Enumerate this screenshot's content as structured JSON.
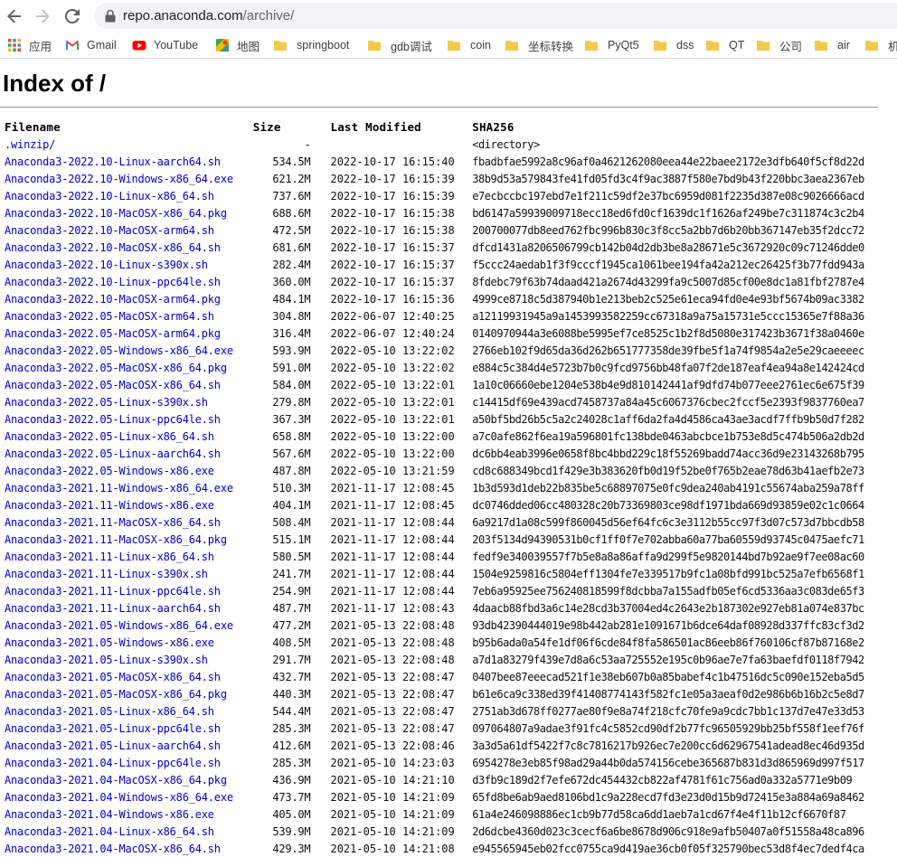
{
  "browser": {
    "url_host": "repo.anaconda.com",
    "url_path": "/archive/",
    "bookmarks": [
      {
        "label": "应用",
        "icon": "apps-grid-icon"
      },
      {
        "label": "Gmail",
        "icon": "gmail-icon"
      },
      {
        "label": "YouTube",
        "icon": "youtube-icon"
      },
      {
        "label": "地图",
        "icon": "maps-icon"
      },
      {
        "label": "springboot",
        "icon": "folder-icon"
      },
      {
        "label": "gdb调试",
        "icon": "folder-icon"
      },
      {
        "label": "coin",
        "icon": "folder-icon"
      },
      {
        "label": "坐标转换",
        "icon": "folder-icon"
      },
      {
        "label": "PyQt5",
        "icon": "folder-icon"
      },
      {
        "label": "dss",
        "icon": "folder-icon"
      },
      {
        "label": "QT",
        "icon": "folder-icon"
      },
      {
        "label": "公司",
        "icon": "folder-icon"
      },
      {
        "label": "air",
        "icon": "folder-icon"
      },
      {
        "label": "机",
        "icon": "folder-icon"
      }
    ]
  },
  "page": {
    "title": "Index of /",
    "columns": [
      "Filename",
      "Size",
      "Last Modified",
      "SHA256"
    ],
    "rows": [
      {
        "name": ".winzip/",
        "size": "-",
        "modified": "",
        "sha": "<directory>"
      },
      {
        "name": "Anaconda3-2022.10-Linux-aarch64.sh",
        "size": "534.5M",
        "modified": "2022-10-17 16:15:40",
        "sha": "fbadbfae5992a8c96af0a4621262080eea44e22baee2172e3dfb640f5cf8d22d"
      },
      {
        "name": "Anaconda3-2022.10-Windows-x86_64.exe",
        "size": "621.2M",
        "modified": "2022-10-17 16:15:39",
        "sha": "38b9d53a579843fe41fd05fd3c4f9ac3887f580e7bd9b43f220bbc3aea2367eb"
      },
      {
        "name": "Anaconda3-2022.10-Linux-x86_64.sh",
        "size": "737.6M",
        "modified": "2022-10-17 16:15:39",
        "sha": "e7ecbccbc197ebd7e1f211c59df2e37bc6959d081f2235d387e08c9026666acd"
      },
      {
        "name": "Anaconda3-2022.10-MacOSX-x86_64.pkg",
        "size": "688.6M",
        "modified": "2022-10-17 16:15:38",
        "sha": "bd6147a59939009718ecc18ed6fd0cf1639dc1f1626af249be7c311874c3c2b4"
      },
      {
        "name": "Anaconda3-2022.10-MacOSX-arm64.sh",
        "size": "472.5M",
        "modified": "2022-10-17 16:15:38",
        "sha": "200700077db8eed762fbc996b830c3f8cc5a2bb7d6b20bb367147eb35f2dcc72"
      },
      {
        "name": "Anaconda3-2022.10-MacOSX-x86_64.sh",
        "size": "681.6M",
        "modified": "2022-10-17 16:15:37",
        "sha": "dfcd1431a8206506799cb142b04d2db3be8a28671e5c3672920c09c71246dde0"
      },
      {
        "name": "Anaconda3-2022.10-Linux-s390x.sh",
        "size": "282.4M",
        "modified": "2022-10-17 16:15:37",
        "sha": "f5ccc24aedab1f3f9cccf1945ca1061bee194fa42a212ec26425f3b77fdd943a"
      },
      {
        "name": "Anaconda3-2022.10-Linux-ppc64le.sh",
        "size": "360.0M",
        "modified": "2022-10-17 16:15:37",
        "sha": "8fdebc79f63b74daad421a2674d43299fa9c5007d85cf00e8dc1a81fbf2787e4"
      },
      {
        "name": "Anaconda3-2022.10-MacOSX-arm64.pkg",
        "size": "484.1M",
        "modified": "2022-10-17 16:15:36",
        "sha": "4999ce8718c5d387940b1e213beb2c525e61eca94fd0e4e93bf5674b09ac3382"
      },
      {
        "name": "Anaconda3-2022.05-MacOSX-arm64.sh",
        "size": "304.8M",
        "modified": "2022-06-07 12:40:25",
        "sha": "a12119931945a9a1453993582259cc67318a9a75a15731e5ccc15365e7f88a36"
      },
      {
        "name": "Anaconda3-2022.05-MacOSX-arm64.pkg",
        "size": "316.4M",
        "modified": "2022-06-07 12:40:24",
        "sha": "0140970944a3e6088be5995ef7ce8525c1b2f8d5080e317423b3671f38a0460e"
      },
      {
        "name": "Anaconda3-2022.05-Windows-x86_64.exe",
        "size": "593.9M",
        "modified": "2022-05-10 13:22:02",
        "sha": "2766eb102f9d65da36d262b651777358de39fbe5f1a74f9854a2e5e29caeeeec"
      },
      {
        "name": "Anaconda3-2022.05-MacOSX-x86_64.pkg",
        "size": "591.0M",
        "modified": "2022-05-10 13:22:02",
        "sha": "e884c5c384d4e5723b7b0c9fcd9756bb48fa07f2de187eaf4ea94a8e142424cd"
      },
      {
        "name": "Anaconda3-2022.05-MacOSX-x86_64.sh",
        "size": "584.0M",
        "modified": "2022-05-10 13:22:01",
        "sha": "1a10c06660ebe1204e538b4e9d810142441af9dfd74b077eee2761ec6e675f39"
      },
      {
        "name": "Anaconda3-2022.05-Linux-s390x.sh",
        "size": "279.8M",
        "modified": "2022-05-10 13:22:01",
        "sha": "c14415df69e439acd7458737a84a45c6067376cbec2fccf5e2393f9837760ea7"
      },
      {
        "name": "Anaconda3-2022.05-Linux-ppc64le.sh",
        "size": "367.3M",
        "modified": "2022-05-10 13:22:01",
        "sha": "a50bf5bd26b5c5a2c24028c1aff6da2fa4d4586ca43ae3acdf7ffb9b50d7f282"
      },
      {
        "name": "Anaconda3-2022.05-Linux-x86_64.sh",
        "size": "658.8M",
        "modified": "2022-05-10 13:22:00",
        "sha": "a7c0afe862f6ea19a596801fc138bde0463abcbce1b753e8d5c474b506a2db2d"
      },
      {
        "name": "Anaconda3-2022.05-Linux-aarch64.sh",
        "size": "567.6M",
        "modified": "2022-05-10 13:22:00",
        "sha": "dc6bb4eab3996e0658f8bc4bbd229c18f55269badd74acc36d9e23143268b795"
      },
      {
        "name": "Anaconda3-2022.05-Windows-x86.exe",
        "size": "487.8M",
        "modified": "2022-05-10 13:21:59",
        "sha": "cd8c688349bcd1f429e3b383620fb0d19f52be0f765b2eae78d63b41aefb2e73"
      },
      {
        "name": "Anaconda3-2021.11-Windows-x86_64.exe",
        "size": "510.3M",
        "modified": "2021-11-17 12:08:45",
        "sha": "1b3d593d1deb22b835be5c68897075e0fc9dea240ab4191c55674aba259a78ff"
      },
      {
        "name": "Anaconda3-2021.11-Windows-x86.exe",
        "size": "404.1M",
        "modified": "2021-11-17 12:08:45",
        "sha": "dc0746dded06cc480328c20b73369803ce98df1971bda669d93859e02c1c0664"
      },
      {
        "name": "Anaconda3-2021.11-MacOSX-x86_64.sh",
        "size": "508.4M",
        "modified": "2021-11-17 12:08:44",
        "sha": "6a9217d1a08c599f860045d56ef64fc6c3e3112b55cc97f3d07c573d7bbcdb58"
      },
      {
        "name": "Anaconda3-2021.11-MacOSX-x86_64.pkg",
        "size": "515.1M",
        "modified": "2021-11-17 12:08:44",
        "sha": "203f5134d94390531b0cf1ff0f7e702abba60a77ba60559d93745c0475aefc71"
      },
      {
        "name": "Anaconda3-2021.11-Linux-x86_64.sh",
        "size": "580.5M",
        "modified": "2021-11-17 12:08:44",
        "sha": "fedf9e340039557f7b5e8a8a86affa9d299f5e9820144bd7b92ae9f7ee08ac60"
      },
      {
        "name": "Anaconda3-2021.11-Linux-s390x.sh",
        "size": "241.7M",
        "modified": "2021-11-17 12:08:44",
        "sha": "1504e9259816c5804eff1304fe7e339517b9fc1a08bfd991bc525a7efb6568f1"
      },
      {
        "name": "Anaconda3-2021.11-Linux-ppc64le.sh",
        "size": "254.9M",
        "modified": "2021-11-17 12:08:44",
        "sha": "7eb6a95925ee756240818599f8dcbba7a155adfb05ef6cd5336aa3c083de65f3"
      },
      {
        "name": "Anaconda3-2021.11-Linux-aarch64.sh",
        "size": "487.7M",
        "modified": "2021-11-17 12:08:43",
        "sha": "4daacb88fbd3a6c14e28cd3b37004ed4c2643e2b187302e927eb81a074e837bc"
      },
      {
        "name": "Anaconda3-2021.05-Windows-x86_64.exe",
        "size": "477.2M",
        "modified": "2021-05-13 22:08:48",
        "sha": "93db42390444019e98b442ab281e1091671b6dce64daf08928d337ffc83cf3d2"
      },
      {
        "name": "Anaconda3-2021.05-Windows-x86.exe",
        "size": "408.5M",
        "modified": "2021-05-13 22:08:48",
        "sha": "b95b6ada0a54fe1df06f6cde84f8fa586501ac86eeb86f760106cf87b87168e2"
      },
      {
        "name": "Anaconda3-2021.05-Linux-s390x.sh",
        "size": "291.7M",
        "modified": "2021-05-13 22:08:48",
        "sha": "a7d1a83279f439e7d8a6c53aa725552e195c0b96ae7e7fa63baefdf0118f7942"
      },
      {
        "name": "Anaconda3-2021.05-MacOSX-x86_64.sh",
        "size": "432.7M",
        "modified": "2021-05-13 22:08:47",
        "sha": "0407bee87eeecad521f1e38eb607b0a85babef4c1b47516dc5c090e152eba5d5"
      },
      {
        "name": "Anaconda3-2021.05-MacOSX-x86_64.pkg",
        "size": "440.3M",
        "modified": "2021-05-13 22:08:47",
        "sha": "b61e6ca9c338ed39f41408774143f582fc1e05a3aeaf0d2e986b6b16b2c5e8d7"
      },
      {
        "name": "Anaconda3-2021.05-Linux-x86_64.sh",
        "size": "544.4M",
        "modified": "2021-05-13 22:08:47",
        "sha": "2751ab3d678ff0277ae80f9e8a74f218cfc70fe9a9cdc7bb1c137d7e47e33d53"
      },
      {
        "name": "Anaconda3-2021.05-Linux-ppc64le.sh",
        "size": "285.3M",
        "modified": "2021-05-13 22:08:47",
        "sha": "097064807a9adae3f91fc4c5852cd90df2b77fc96505929bb25bf558f1eef76f"
      },
      {
        "name": "Anaconda3-2021.05-Linux-aarch64.sh",
        "size": "412.6M",
        "modified": "2021-05-13 22:08:46",
        "sha": "3a3d5a61df5422f7c8c7816217b926ec7e200cc6d62967541adead8ec46d935d"
      },
      {
        "name": "Anaconda3-2021.04-Linux-ppc64le.sh",
        "size": "285.3M",
        "modified": "2021-05-10 14:23:03",
        "sha": "6954278e3eb85f98ad29a44b0da574156cebe365687b831d3d865969d997f517"
      },
      {
        "name": "Anaconda3-2021.04-MacOSX-x86_64.pkg",
        "size": "436.9M",
        "modified": "2021-05-10 14:21:10",
        "sha": "d3fb9c189d2f7efe672dc454432cb822af4781f61c756ad0a332a5771e9b09"
      },
      {
        "name": "Anaconda3-2021.04-Windows-x86_64.exe",
        "size": "473.7M",
        "modified": "2021-05-10 14:21:09",
        "sha": "65fd8be6ab9aed8106bd1c9a228ecd7fd3e23d0d15b9d72415e3a884a69a8462"
      },
      {
        "name": "Anaconda3-2021.04-Windows-x86.exe",
        "size": "405.0M",
        "modified": "2021-05-10 14:21:09",
        "sha": "61a4e246098886ec1cb9b77d58ca6dd1aeb7a1cd67f4e4f11b12cf6670f87"
      },
      {
        "name": "Anaconda3-2021.04-Linux-x86_64.sh",
        "size": "539.9M",
        "modified": "2021-05-10 14:21:09",
        "sha": "2d6dcbe4360d023c3cecf6a6be8678d906c918e9afb50407a0f51558a48ca896"
      },
      {
        "name": "Anaconda3-2021.04-MacOSX-x86_64.sh",
        "size": "429.3M",
        "modified": "2021-05-10 14:21:08",
        "sha": "e945565945eb02fcc0755ca9d419ae36cb0f05f325790bec53d8f4ec7dedf4ca"
      }
    ]
  }
}
